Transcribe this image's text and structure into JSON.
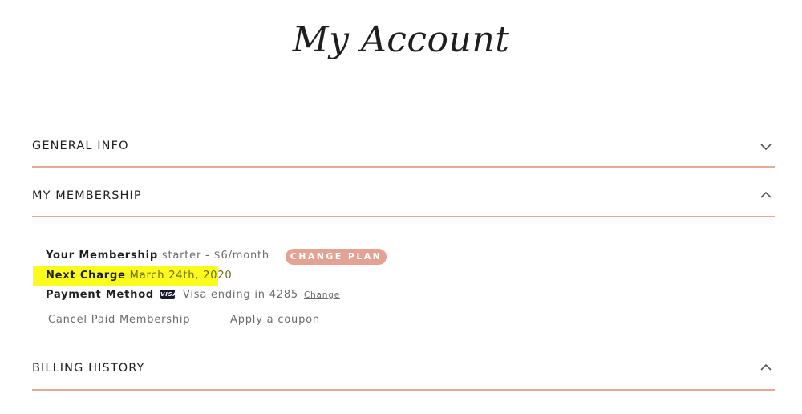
{
  "page": {
    "title": "My Account"
  },
  "sections": [
    {
      "label": "GENERAL INFO",
      "state": "collapsed",
      "icon": "chevron-down-icon"
    },
    {
      "label": "MY MEMBERSHIP",
      "state": "expanded",
      "icon": "chevron-up-icon"
    },
    {
      "label": "BILLING HISTORY",
      "state": "expanded",
      "icon": "chevron-up-icon"
    }
  ],
  "membership": {
    "plan_key": "Your Membership",
    "plan_value": "starter - $6/month",
    "change_plan_label": "CHANGE PLAN",
    "next_charge_key": "Next Charge",
    "next_charge_value": "March 24th, 2020",
    "payment_key": "Payment Method",
    "card_badge": "VISA",
    "card_text": "Visa ending in 4285",
    "change_link": "Change",
    "cancel_label": "Cancel Paid Membership",
    "coupon_label": "Apply a coupon"
  },
  "colors": {
    "accent": "#e3a394",
    "divider": "#e4aa96",
    "highlight": "#fbfb1e",
    "text": "#1e1e1e",
    "muted": "#6b6b6b"
  }
}
